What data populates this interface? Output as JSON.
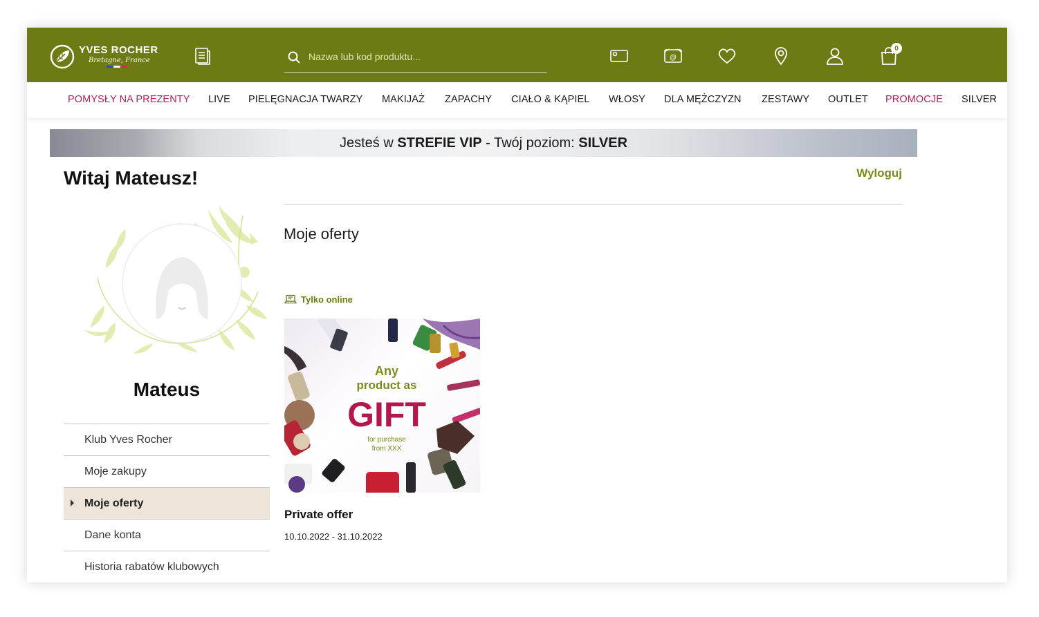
{
  "header": {
    "logo_name": "YVES ROCHER",
    "logo_tagline": "Bretagne, France",
    "search_placeholder": "Nazwa lub kod produktu...",
    "cart_count": "0",
    "icons": [
      "catalog-icon",
      "search-icon",
      "card-icon",
      "email-icon",
      "heart-icon",
      "location-icon",
      "user-icon",
      "shopping-bag-icon"
    ],
    "brand_color": "#6e7a13"
  },
  "nav": {
    "items": [
      {
        "label": "POMYSŁY NA PREZENTY",
        "highlight": true
      },
      {
        "label": "LIVE",
        "highlight": false
      },
      {
        "label": "PIELĘGNACJA TWARZY",
        "highlight": false
      },
      {
        "label": "MAKIJAŻ",
        "highlight": false
      },
      {
        "label": "ZAPACHY",
        "highlight": false
      },
      {
        "label": "CIAŁO & KĄPIEL",
        "highlight": false
      },
      {
        "label": "WŁOSY",
        "highlight": false
      },
      {
        "label": "DLA MĘŻCZYZN",
        "highlight": false
      },
      {
        "label": "ZESTAWY",
        "highlight": false
      },
      {
        "label": "OUTLET",
        "highlight": false
      },
      {
        "label": "PROMOCJE",
        "highlight": true
      },
      {
        "label": "SILVER",
        "highlight": false
      }
    ],
    "highlight_color": "#b81e5a"
  },
  "vip_banner": {
    "prefix": "Jesteś w ",
    "zone": "STREFIE VIP",
    "middle": " - Twój poziom: ",
    "level": "SILVER"
  },
  "account": {
    "welcome": "Witaj Mateusz!",
    "logout": "Wyloguj",
    "username": "Mateus",
    "menu": [
      {
        "label": "Klub Yves Rocher",
        "active": false
      },
      {
        "label": "Moje zakupy",
        "active": false
      },
      {
        "label": "Moje oferty",
        "active": true
      },
      {
        "label": "Dane konta",
        "active": false
      },
      {
        "label": "Historia rabatów klubowych",
        "active": false
      }
    ]
  },
  "offers": {
    "title": "Moje oferty",
    "items": [
      {
        "tag": "Tylko online",
        "image_text": {
          "line1": "Any",
          "line2": "product as",
          "headline": "GIFT",
          "small1": "for purchase",
          "small2": "from XXX"
        },
        "title": "Private offer",
        "dates": "10.10.2022 - 31.10.2022"
      }
    ]
  }
}
